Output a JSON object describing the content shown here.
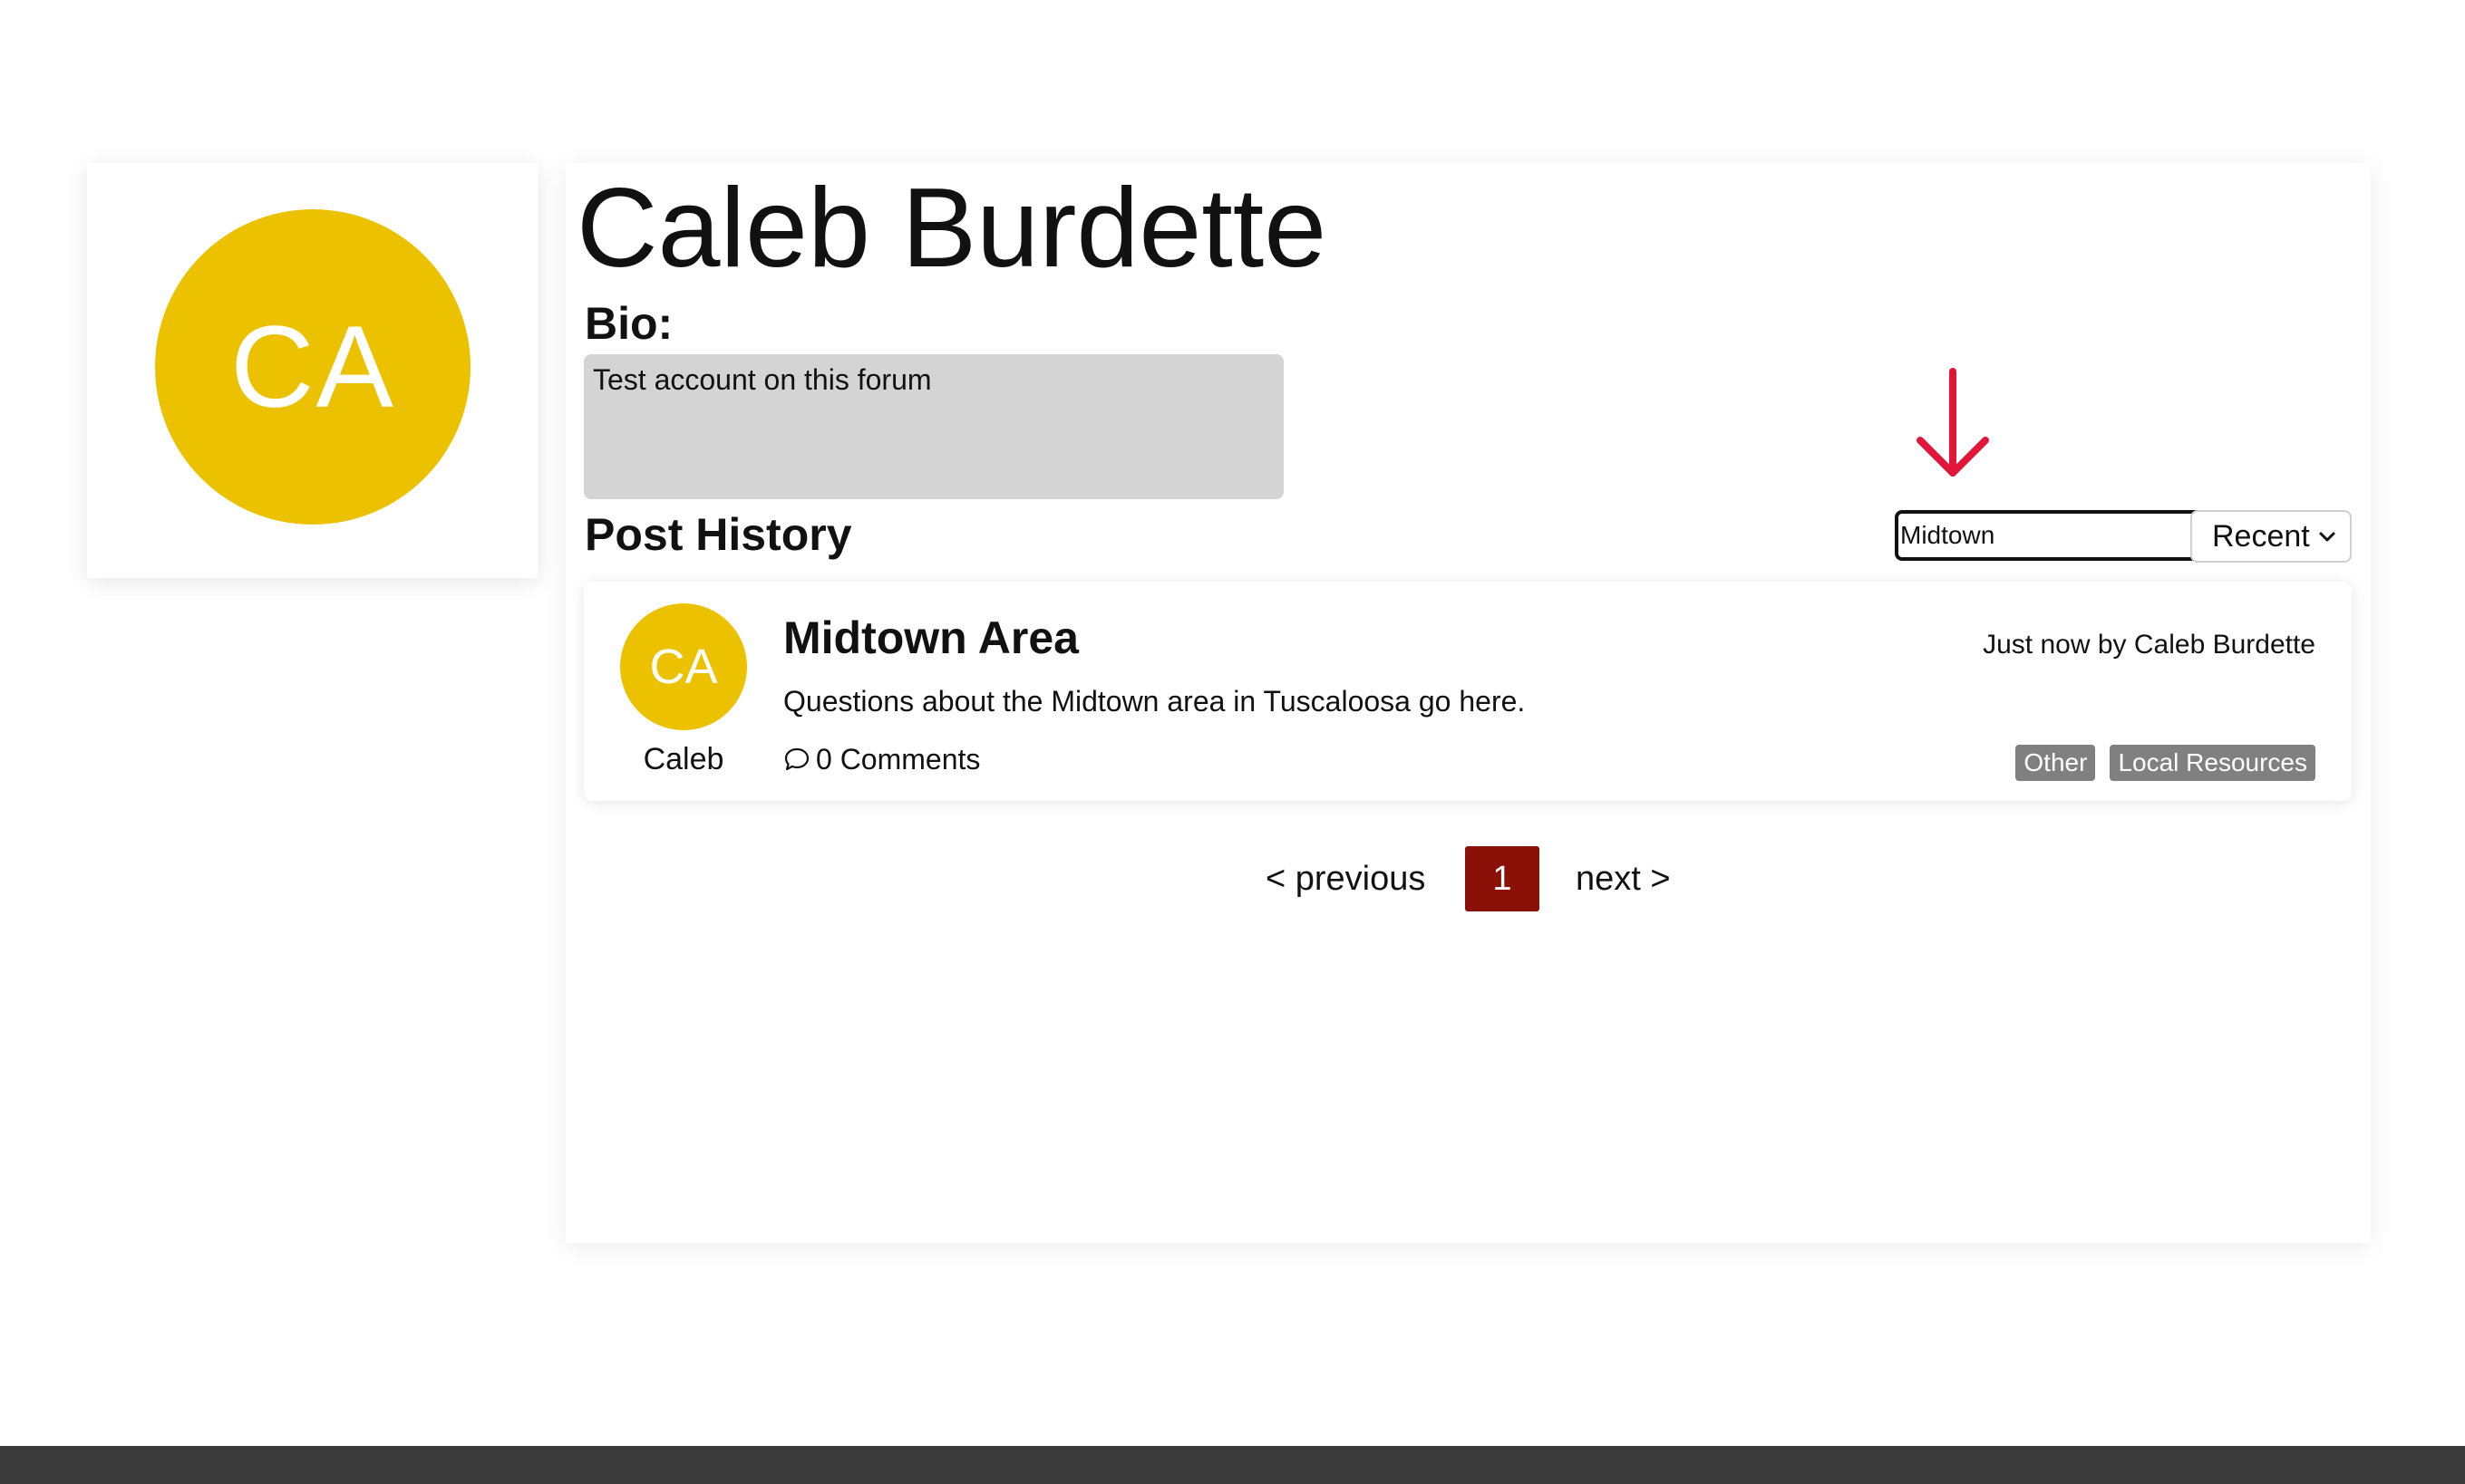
{
  "colors": {
    "avatar_bg": "#ecc200",
    "page_active_bg": "#8b1108",
    "annotation_arrow": "#e0173a",
    "clear_icon": "#2f4f8f",
    "footer": "#3a3a3a"
  },
  "profile": {
    "avatar_initials": "CA",
    "name": "Caleb Burdette",
    "bio_label": "Bio:",
    "bio_text": "Test account on this forum"
  },
  "post_history": {
    "label": "Post History",
    "search": {
      "value": "Midtown",
      "clear_icon": "close-icon"
    },
    "sort": {
      "selected": "Recent",
      "icon": "chevron-down-icon"
    },
    "posts": [
      {
        "avatar_initials": "CA",
        "author_short": "Caleb",
        "title": "Midtown Area",
        "meta": "Just now by Caleb Burdette",
        "body": "Questions about the Midtown area in Tuscaloosa go here.",
        "comments": "0 Comments",
        "comment_icon": "comment-bubble-icon",
        "tags": [
          "Other",
          "Local Resources"
        ]
      }
    ]
  },
  "pagination": {
    "previous": "< previous",
    "current": "1",
    "next": "next >"
  }
}
